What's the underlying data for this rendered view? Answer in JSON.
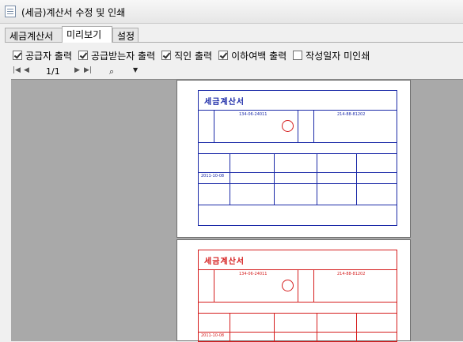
{
  "window": {
    "title": "(세금)계산서 수정 및 인쇄"
  },
  "tabs": [
    {
      "label": "세금계산서",
      "active": false
    },
    {
      "label": "미리보기",
      "active": true
    },
    {
      "label": "설정",
      "active": false
    }
  ],
  "options": [
    {
      "label": "공급자 출력",
      "checked": true
    },
    {
      "label": "공급받는자 출력",
      "checked": true
    },
    {
      "label": "직인 출력",
      "checked": true
    },
    {
      "label": "이하여백 출력",
      "checked": true
    },
    {
      "label": "작성일자 미인쇄",
      "checked": false
    }
  ],
  "toolbar": {
    "page_indicator": "1/1"
  },
  "preview": {
    "doc_title": "세금계산서",
    "supplier_reg_no": "134-06-24011",
    "buyer_reg_no": "214-88-81202",
    "date": "2011-10-08",
    "page1_color": "#1b2aa8",
    "page2_color": "#d51d1d"
  }
}
